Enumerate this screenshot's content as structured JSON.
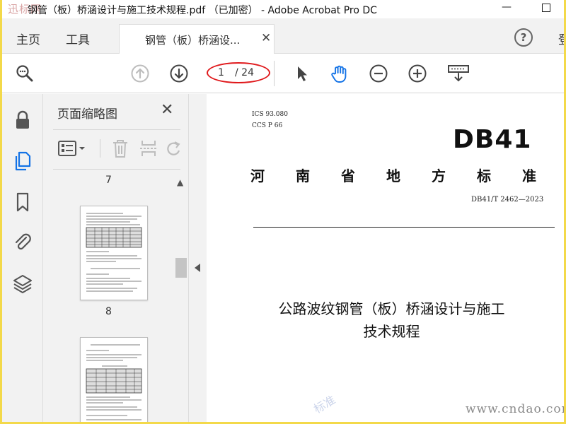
{
  "window": {
    "logo_text": "迅标网",
    "title": "钢管（板）桥涵设计与施工技术规程.pdf （已加密） - Adobe Acrobat Pro DC"
  },
  "menu": {
    "home": "主页",
    "tools": "工具",
    "tab_label": "钢管（板）桥涵设...",
    "signin_partial": "登"
  },
  "toolbar": {
    "page_current": "1",
    "page_total": "/ 24"
  },
  "thumbnails_panel": {
    "title": "页面缩略图",
    "pages": [
      "7",
      "8"
    ]
  },
  "document": {
    "ics": "ICS  93.080",
    "ccs": "CCS  P  66",
    "code": "DB41",
    "standard_title": "河南省地方标准",
    "standard_number": "DB41/T  2462—2023",
    "title_line1": "公路波纹钢管（板）桥涵设计与施工",
    "title_line2": "技术规程",
    "watermark_site": "www.cndao.com",
    "watermark_faint": "标准"
  },
  "colors": {
    "accent_blue": "#1473e6",
    "annotation_red": "#e0191c",
    "frame_yellow": "#f3d94a"
  }
}
